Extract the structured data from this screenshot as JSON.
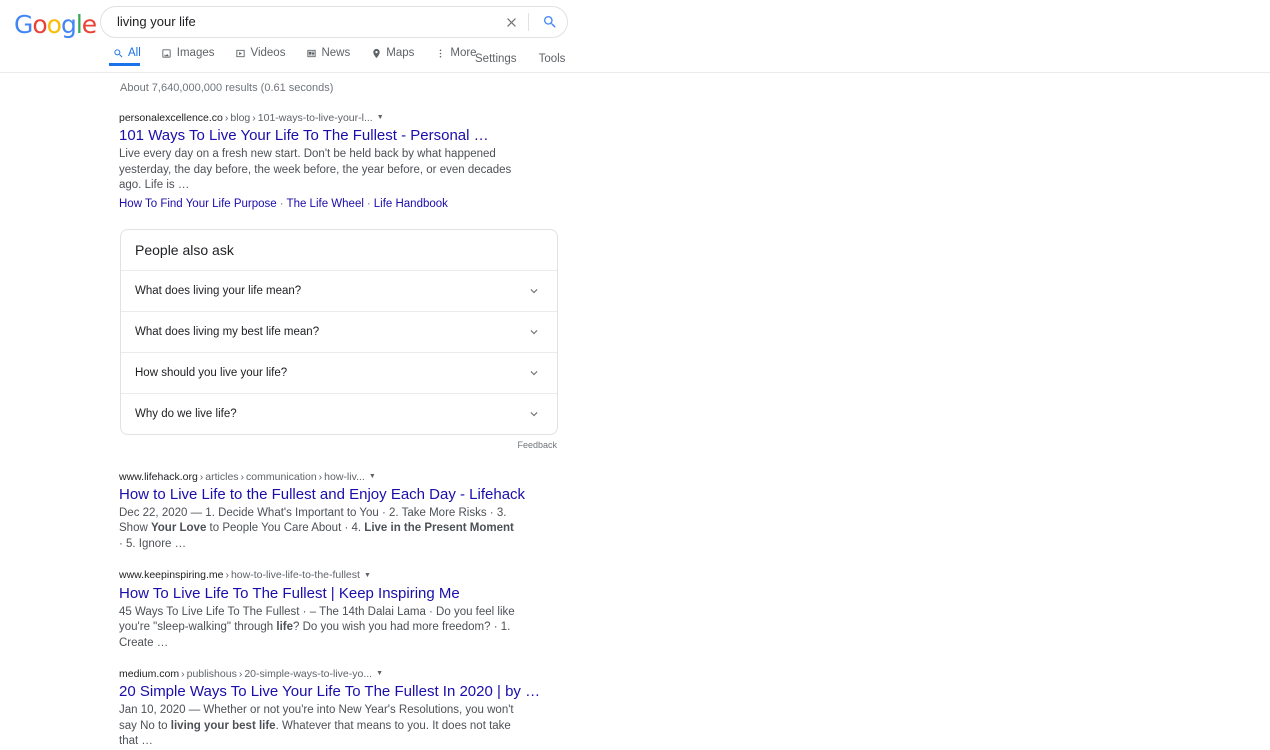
{
  "brand": {
    "logo_letters": [
      {
        "char": "G",
        "color": "#4285F4"
      },
      {
        "char": "o",
        "color": "#EA4335"
      },
      {
        "char": "o",
        "color": "#FBBC05"
      },
      {
        "char": "g",
        "color": "#4285F4"
      },
      {
        "char": "l",
        "color": "#34A853"
      },
      {
        "char": "e",
        "color": "#EA4335"
      }
    ],
    "accent_blue": "#1a73e8",
    "link_blue": "#1a0dab"
  },
  "search": {
    "value": "living your life",
    "placeholder": "Search",
    "clear_icon": "close-icon",
    "submit_icon": "search-icon"
  },
  "nav": {
    "tabs": [
      {
        "label": "All",
        "icon": "search-icon",
        "active": true
      },
      {
        "label": "Images",
        "icon": "image-icon",
        "active": false
      },
      {
        "label": "Videos",
        "icon": "video-icon",
        "active": false
      },
      {
        "label": "News",
        "icon": "news-icon",
        "active": false
      },
      {
        "label": "Maps",
        "icon": "map-pin-icon",
        "active": false
      },
      {
        "label": "More",
        "icon": "more-vertical-icon",
        "active": false
      }
    ],
    "right": [
      {
        "label": "Settings"
      },
      {
        "label": "Tools"
      }
    ]
  },
  "results_stats": "About 7,640,000,000 results (0.61 seconds)",
  "results": [
    {
      "domain": "personalexcellence.co",
      "path": [
        "blog",
        "101-ways-to-live-your-l..."
      ],
      "title": "101 Ways To Live Your Life To The Fullest - Personal …",
      "snippet_html": "Live every day on a fresh new start. Don't be held back by what happened yesterday, the day before, the week before, the year before, or even decades ago. Life is …",
      "sitelinks": [
        "How To Find Your Life Purpose",
        "The Life Wheel",
        "Life Handbook"
      ]
    },
    {
      "domain": "www.lifehack.org",
      "path": [
        "articles",
        "communication",
        "how-liv..."
      ],
      "title": "How to Live Life to the Fullest and Enjoy Each Day - Lifehack",
      "snippet_html": "Dec 22, 2020 — 1. Decide What's Important to You · 2. Take More Risks · 3. Show <b>Your Love</b> to People You Care About · 4. <b>Live in the Present Moment</b> · 5. Ignore …"
    },
    {
      "domain": "www.keepinspiring.me",
      "path": [
        "how-to-live-life-to-the-fullest"
      ],
      "title": "How To Live Life To The Fullest | Keep Inspiring Me",
      "snippet_html": "45 Ways To Live Life To The Fullest · – The 14th Dalai Lama · Do you feel like you're \"sleep-walking\" through <b>life</b>? Do you wish you had more freedom? · 1. Create …"
    },
    {
      "domain": "medium.com",
      "path": [
        "publishous",
        "20-simple-ways-to-live-yo..."
      ],
      "title": "20 Simple Ways To Live Your Life To The Fullest In 2020 | by …",
      "snippet_html": "Jan 10, 2020 — Whether or not you're into New Year's Resolutions, you won't say No to <b>living your best life</b>. Whatever that means to you. It does not take that …"
    }
  ],
  "people_also_ask": {
    "heading": "People also ask",
    "questions": [
      "What does living your life mean?",
      "What does living my best life mean?",
      "How should you live your life?",
      "Why do we live life?"
    ],
    "feedback_label": "Feedback",
    "chevron_icon": "chevron-down-icon"
  }
}
